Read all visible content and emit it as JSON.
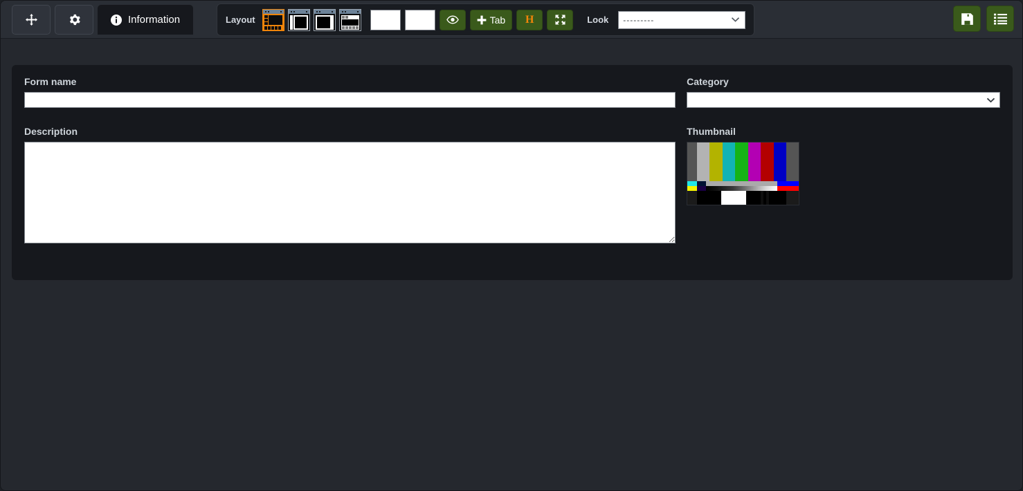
{
  "app": {
    "background_color": "#25282e",
    "panel_color": "#16181d",
    "accent_color": "#f0850a",
    "green_button_color": "#3a5a1b",
    "label_color": "#ced4da"
  },
  "toolbar": {
    "tabs": [
      {
        "id": "move",
        "icon": "move-arrows-icon",
        "label": "",
        "active": false
      },
      {
        "id": "settings",
        "icon": "gear-icon",
        "label": "",
        "active": false
      },
      {
        "id": "information",
        "icon": "info-circle-icon",
        "label": "Information",
        "active": true
      }
    ],
    "layout_group": {
      "label": "Layout",
      "options": [
        {
          "id": "layout-sidebar-left-bottom",
          "selected": true
        },
        {
          "id": "layout-split-left",
          "selected": false
        },
        {
          "id": "layout-centered",
          "selected": false
        },
        {
          "id": "layout-top-tabs",
          "selected": false
        }
      ],
      "blank_buttons": [
        {
          "id": "blank-button-1",
          "label": ""
        },
        {
          "id": "blank-button-2",
          "label": ""
        }
      ],
      "actions": [
        {
          "id": "preview",
          "icon": "eye-icon",
          "label": ""
        },
        {
          "id": "add-tab",
          "icon": "plus-icon",
          "label": "Tab"
        },
        {
          "id": "heading",
          "icon": "",
          "label": "H"
        },
        {
          "id": "fullscreen",
          "icon": "expand-arrows-icon",
          "label": ""
        }
      ],
      "look": {
        "label": "Look",
        "value": "---------",
        "options": [
          "---------"
        ]
      }
    },
    "right_actions": [
      {
        "id": "save",
        "icon": "floppy-disk-icon",
        "label": ""
      },
      {
        "id": "list",
        "icon": "list-icon",
        "label": ""
      }
    ]
  },
  "form": {
    "form_name": {
      "label": "Form name",
      "value": "",
      "placeholder": ""
    },
    "description": {
      "label": "Description",
      "value": "",
      "placeholder": ""
    },
    "category": {
      "label": "Category",
      "value": "",
      "options": [
        ""
      ]
    },
    "thumbnail": {
      "label": "Thumbnail",
      "alt": "smpte-color-bars-test-pattern",
      "pattern": {
        "row1": [
          "#555555",
          "#b3b3b3",
          "#b3b300",
          "#12b3b3",
          "#15b315",
          "#b300b3",
          "#b30000",
          "#0000c4",
          "#555555"
        ],
        "row2": [
          "#22e8e8",
          "#001133",
          "#aaaaaa",
          "#141414",
          "#0000ff",
          "#ff0000"
        ],
        "row2b": [
          "#f4f400",
          "#1a0045",
          "#111111",
          "#ff0000"
        ],
        "row3": [
          "#1b1b1b",
          "#000000",
          "#ffffff",
          "#000000",
          "#0d0d0d",
          "#000000",
          "#1b1b1b"
        ]
      }
    }
  }
}
